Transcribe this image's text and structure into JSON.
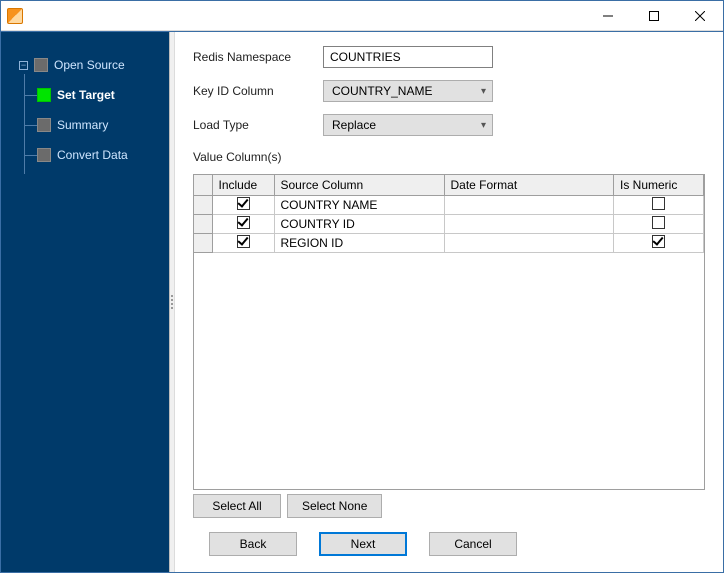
{
  "sidebar": {
    "items": [
      {
        "label": "Open Source"
      },
      {
        "label": "Set Target"
      },
      {
        "label": "Summary"
      },
      {
        "label": "Convert Data"
      }
    ]
  },
  "form": {
    "redisNamespace": {
      "label": "Redis Namespace",
      "value": "COUNTRIES"
    },
    "keyIdColumn": {
      "label": "Key ID Column",
      "value": "COUNTRY_NAME"
    },
    "loadType": {
      "label": "Load Type",
      "value": "Replace"
    },
    "valueColumnsLabel": "Value Column(s)"
  },
  "grid": {
    "headers": {
      "include": "Include",
      "source": "Source Column",
      "dateFormat": "Date Format",
      "isNumeric": "Is Numeric"
    },
    "rows": [
      {
        "include": true,
        "source": "COUNTRY NAME",
        "dateFormat": "",
        "isNumeric": false
      },
      {
        "include": true,
        "source": "COUNTRY ID",
        "dateFormat": "",
        "isNumeric": false
      },
      {
        "include": true,
        "source": "REGION ID",
        "dateFormat": "",
        "isNumeric": true
      }
    ]
  },
  "buttons": {
    "selectAll": "Select All",
    "selectNone": "Select None",
    "back": "Back",
    "next": "Next",
    "cancel": "Cancel"
  }
}
